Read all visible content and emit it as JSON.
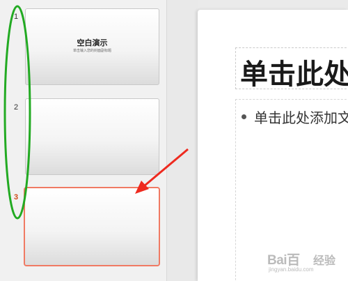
{
  "thumbnails": [
    {
      "number": "1",
      "title": "空白演示",
      "subtitle": "单击输入您的封面副标题"
    },
    {
      "number": "2"
    },
    {
      "number": "3"
    }
  ],
  "slide": {
    "title_placeholder": "单击此处",
    "body_placeholder": "单击此处添加文"
  },
  "watermark": {
    "logo": "Bai百",
    "brand": "经验",
    "url": "jingyan.baidu.com"
  },
  "colors": {
    "selected_border": "#f07a63",
    "active_number": "#d04a1a",
    "annotation_ellipse": "#22aa22",
    "annotation_arrow": "#ee2a1f"
  }
}
